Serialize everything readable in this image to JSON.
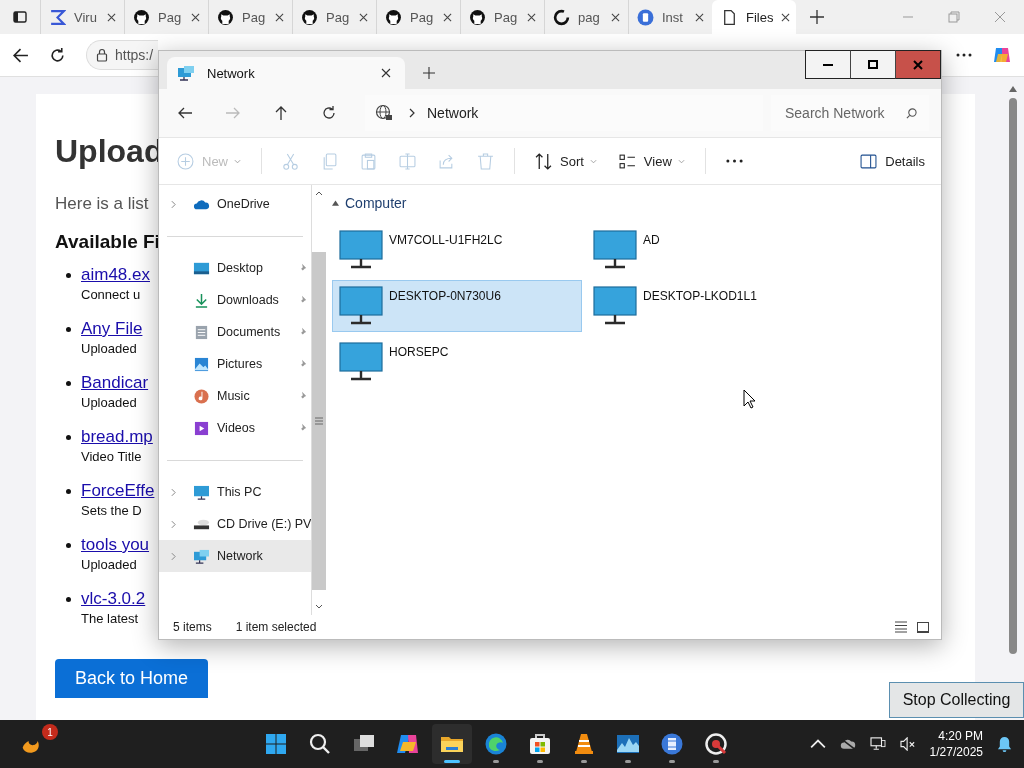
{
  "browser": {
    "tabs": [
      {
        "label": "Viru",
        "kind": "sigma",
        "selected": false
      },
      {
        "label": "Pag",
        "kind": "github",
        "selected": false
      },
      {
        "label": "Pag",
        "kind": "github",
        "selected": false
      },
      {
        "label": "Pag",
        "kind": "github",
        "selected": false
      },
      {
        "label": "Pag",
        "kind": "github",
        "selected": false
      },
      {
        "label": "Pag",
        "kind": "github",
        "selected": false
      },
      {
        "label": "pag",
        "kind": "ring",
        "selected": false
      },
      {
        "label": "Inst",
        "kind": "badge",
        "selected": false
      },
      {
        "label": "Files",
        "kind": "page",
        "selected": true
      }
    ],
    "address": "https:/",
    "page": {
      "heading": "Upload",
      "intro": "Here is a list",
      "section": "Available Fi",
      "files": [
        {
          "name": "aim48.ex",
          "description": "Connect u"
        },
        {
          "name": "Any File",
          "description": "Uploaded"
        },
        {
          "name": "Bandicar",
          "description": "Uploaded"
        },
        {
          "name": "bread.mp",
          "description": "Video Title"
        },
        {
          "name": "ForceEffe",
          "description": "Sets the D"
        },
        {
          "name": "tools you",
          "description": "Uploaded"
        },
        {
          "name": "vlc-3.0.2",
          "description": "The latest"
        }
      ],
      "back_button": "Back to Home"
    }
  },
  "explorer": {
    "tab_title": "Network",
    "breadcrumb": "Network",
    "search": {
      "placeholder": "Search Network"
    },
    "nav_buttons": [
      {
        "kind": "back",
        "disabled": false
      },
      {
        "kind": "forward",
        "disabled": true
      },
      {
        "kind": "up",
        "disabled": false
      },
      {
        "kind": "refresh",
        "disabled": false
      }
    ],
    "toolbar": [
      [
        {
          "kind": "new",
          "label": "New",
          "disabled": true
        }
      ],
      [
        {
          "kind": "cut",
          "disabled": true
        },
        {
          "kind": "copy",
          "disabled": true
        },
        {
          "kind": "paste",
          "disabled": true
        },
        {
          "kind": "rename",
          "disabled": true
        },
        {
          "kind": "share",
          "disabled": true
        },
        {
          "kind": "delete",
          "disabled": true
        }
      ],
      [
        {
          "kind": "sort",
          "label": "Sort",
          "disabled": false
        },
        {
          "kind": "view",
          "label": "View",
          "disabled": false
        }
      ],
      [
        {
          "kind": "more",
          "disabled": false
        }
      ]
    ],
    "details_button": "Details",
    "nav_pane": [
      [
        {
          "kind": "cloud",
          "label": "OneDrive",
          "expandable": true,
          "pinned": false,
          "selected": false
        }
      ],
      [
        {
          "kind": "desktop",
          "label": "Desktop",
          "expandable": false,
          "pinned": true,
          "selected": false
        },
        {
          "kind": "download",
          "label": "Downloads",
          "expandable": false,
          "pinned": true,
          "selected": false
        },
        {
          "kind": "document",
          "label": "Documents",
          "expandable": false,
          "pinned": true,
          "selected": false
        },
        {
          "kind": "pictures",
          "label": "Pictures",
          "expandable": false,
          "pinned": true,
          "selected": false
        },
        {
          "kind": "music",
          "label": "Music",
          "expandable": false,
          "pinned": true,
          "selected": false
        },
        {
          "kind": "videos",
          "label": "Videos",
          "expandable": false,
          "pinned": true,
          "selected": false
        }
      ],
      [
        {
          "kind": "pc",
          "label": "This PC",
          "expandable": true,
          "pinned": false,
          "selected": false
        },
        {
          "kind": "drive",
          "label": "CD Drive (E:) PV",
          "expandable": true,
          "pinned": false,
          "selected": false
        },
        {
          "kind": "network",
          "label": "Network",
          "expandable": true,
          "pinned": false,
          "selected": true
        }
      ]
    ],
    "group": {
      "title": "Computer",
      "expanded": true
    },
    "items": [
      {
        "name": "VM7COLL-U1FH2LC",
        "selected": false
      },
      {
        "name": "AD",
        "selected": false
      },
      {
        "name": "DESKTOP-0N730U6",
        "selected": true
      },
      {
        "name": "DESKTOP-LKOD1L1",
        "selected": false
      },
      {
        "name": "HORSEPC",
        "selected": false
      }
    ],
    "status": {
      "count": "5 items",
      "selection": "1 item selected"
    }
  },
  "stop_button": "Stop Collecting",
  "taskbar": {
    "badge": "1",
    "apps": [
      {
        "kind": "start",
        "running": false,
        "active": false
      },
      {
        "kind": "search",
        "running": false,
        "active": false
      },
      {
        "kind": "taskview",
        "running": false,
        "active": false
      },
      {
        "kind": "copilot",
        "running": false,
        "active": false
      },
      {
        "kind": "explorer",
        "running": true,
        "active": true
      },
      {
        "kind": "edge",
        "running": true,
        "active": false
      },
      {
        "kind": "store",
        "running": true,
        "active": false
      },
      {
        "kind": "vlc",
        "running": true,
        "active": false
      },
      {
        "kind": "monitor",
        "running": true,
        "active": false
      },
      {
        "kind": "film",
        "running": true,
        "active": false
      },
      {
        "kind": "recorder",
        "running": true,
        "active": false
      }
    ],
    "time": "4:20 PM",
    "date": "1/27/2025"
  }
}
